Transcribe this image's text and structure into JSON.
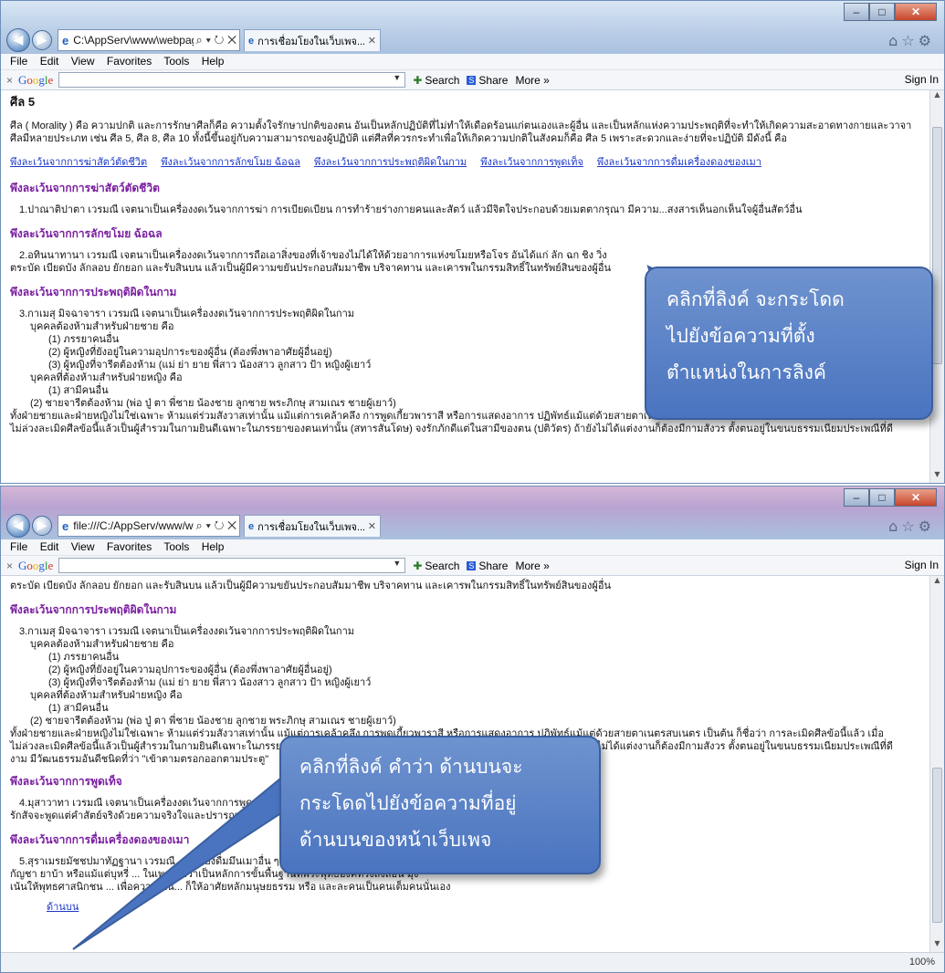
{
  "browser1": {
    "address": "C:\\AppServ\\www\\webpage_htm",
    "tab": "การเชื่อมโยงในเว็บเพจ..."
  },
  "browser2": {
    "address": "file:///C:/AppServ/www/webpag",
    "tab": "การเชื่อมโยงในเว็บเพจ...",
    "zoom": "100%"
  },
  "addr_ctrls": "⌕ ▾ ↻ ✕",
  "menu": [
    "File",
    "Edit",
    "View",
    "Favorites",
    "Tools",
    "Help"
  ],
  "toolbar": {
    "search": "Search",
    "share": "Share",
    "more": "More »",
    "signin": "Sign In"
  },
  "page": {
    "heading": "ศีล 5",
    "intro": "ศีล ( Morality ) คือ ความปกติ และการรักษาศีลก็คือ ความตั้งใจรักษาปกติของตน อันเป็นหลักปฏิบัติที่ไม่ทำให้เดือดร้อนแก่ตนเองและผู้อื่น และเป็นหลักแห่งความประพฤติที่จะทำให้เกิดความสะอาดทางกายและวาจา ศีลมีหลายประเภท เช่น ศีล 5, ศีล 8, ศีล 10 ทั้งนี้ขึ้นอยู่กับความสามารถของผู้ปฏิบัติ แต่ศีลที่ควรกระทำเพื่อให้เกิดความปกติในสังคมก็คือ ศีล 5 เพราะสะดวกและง่ายที่จะปฏิบัติ มีดังนี้ คือ",
    "links": [
      "พึงละเว้นจากการฆ่าสัตว์ตัดชีวิต",
      "พึงละเว้นจากการลักขโมย ฉ้อฉล",
      "พึงละเว้นจากการประพฤติผิดในกาม",
      "พึงละเว้นจากการพูดเท็จ",
      "พึงละเว้นจากการดื่มเครื่องดองของเมา"
    ],
    "s1_head": "พึงละเว้นจากการฆ่าสัตว์ตัดชีวิต",
    "s1_text": "1.ปาณาติปาตา เวรมณี เจตนาเป็นเครื่องงดเว้นจากการฆ่า การเบียดเบียน การทำร้ายร่างกายคนและสัตว์ แล้วมีจิตใจประกอบด้วยเมตตากรุณา มีความ...สงสารเห็นอกเห็นใจผู้อื่นสัตว์อื่น",
    "s2_head": "พึงละเว้นจากการลักขโมย ฉ้อฉล",
    "s2_text1": "2.อทินนาทานา เวรมณี เจตนาเป็นเครื่องงดเว้นจากการถือเอาสิ่งของที่เจ้าของไม่ได้ให้ด้วยอาการแห่งขโมยหรือโจร อันได้แก่ ลัก ฉก ชิง วิ่ง",
    "s2_text2": "ตระบัด เบียดบัง ลักลอบ ยักยอก และรับสินบน แล้วเป็นผู้มีความขยันประกอบสัมมาชีพ บริจาคทาน และเคารพในกรรมสิทธิ์ในทรัพย์สินของผู้อื่น",
    "s3_head": "พึงละเว้นจากการประพฤติผิดในกาม",
    "s3_lines": [
      "3.กาเมสุ มิจฉาจารา เวรมณี เจตนาเป็นเครื่องงดเว้นจากการประพฤติผิดในกาม",
      "บุคคลต้องห้ามสำหรับฝ่ายชาย คือ",
      "(1) ภรรยาคนอื่น",
      "(2) ผู้หญิงที่ยังอยู่ในความอุปการะของผู้อื่น (ต้องพึ่งพาอาศัยผู้อื่นอยู่)",
      "(3) ผู้หญิงที่จารีตต้องห้าม (แม่ ย่า ยาย พี่สาว น้องสาว ลูกสาว ป้า หญิงผู้เยาว์",
      "บุคคลที่ต้องห้ามสำหรับฝ่ายหญิง คือ",
      "(1) สามีคนอื่น",
      "(2) ชายจารีตต้องห้าม (พ่อ ปู่ ตา พี่ชาย น้องชาย ลูกชาย พระภิกษุ สามเณร ชายผู้เยาว์)",
      "ทั้งฝ่ายชายและฝ่ายหญิงไม่ใช่เฉพาะ ห้ามแต่ร่วมสังวาสเท่านั้น แม้แต่การเคล้าคลึง การพูดเกี้ยวพาราสี หรือการแสดงอาการ ปฏิพัทธ์แม้แต่ด้วยสายตาเนตรสบเนตร เป็นต้น ก็ชื่อว่า การละเมิดศีลข้อนี้แล้ว เมื่อ",
      "ไม่ล่วงละเมิดศีลข้อนี้แล้วเป็นผู้สำรวมในกามยินดีเฉพาะในภรรยาของตนเท่านั้น (สทารสันโดษ) จงรักภักดีแต่ในสามีของตน (ปติวัตร) ถ้ายังไม่ได้แต่งงานก็ต้องมีกามสังวร ตั้งตนอยู่ในขนบธรรมเนียมประเพณีที่ดี",
      "งาม มีวัฒนธรรมอันดีชนิดที่ว่า \"เข้าตามตรอกออกตามประตู\""
    ],
    "s4_head": "พึงละเว้นจากการพูดเท็จ",
    "s4_text1": "4.มุสาวาทา เวรมณี เจตนาเป็นเครื่องงดเว้นจากการพูดเท็จ ... รวมคำพูดเสียดแทง สับปลับ ผิดสัญญา เสียสัตย์ และคืนคำ แล้ว เป็นผู้",
    "s4_text2": "รักสัจจะพูดแต่คำสัตย์จริงด้วยความจริงใจและปรารถนาดี",
    "s5_head": "พึงละเว้นจากการดื่มเครื่องดองของเมา",
    "s5_text1": "5.สุราเมรยมัชชปมาทัฏฐานา เวรมณี ... เครื่องดื่มมึนเมาอื่น ๆ และการเสพยาเสพติดอื่นๆ เช่น ฝิ่น เฮโรอีน",
    "s5_text2": "กัญชา ยาบ้า หรือแม้แต่บุหรี่ ... ในเพศ นับว่าเป็นหลักการขั้นพื้นฐานที่พระพุทธองค์ทรงสั่งสอน มุ่ง",
    "s5_text3": "เน้นให้พุทธศาสนิกชน ... เพื่อความเป็น... ก็ให้อาศัยหลักมนุษยธรรม หรือ และละคนเป็นคนเต็มคนนั่นเอง",
    "top_link": "ด้านบน"
  },
  "callouts": {
    "c1": [
      "คลิกที่ลิงค์ จะกระโดด",
      "ไปยังข้อความที่ตั้ง",
      "ตำแหน่งในการลิงค์"
    ],
    "c2": [
      "คลิกที่ลิงค์ คำว่า ด้านบนจะ",
      "กระโดดไปยังข้อความที่อยู่",
      "ด้านบนของหน้าเว็บเพจ"
    ]
  },
  "colors": {
    "link": "#1c37c8",
    "section_heading": "#7a1fa0",
    "callout": "#4a74c0"
  }
}
